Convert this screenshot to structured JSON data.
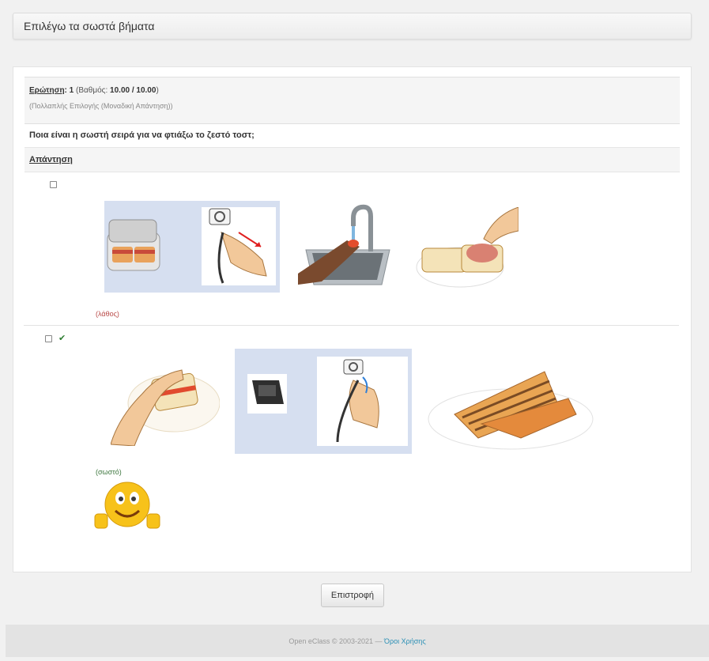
{
  "page": {
    "title": "Επιλέγω τα σωστά βήματα"
  },
  "question": {
    "label": "Ερώτηση",
    "number_suffix": ": 1",
    "grade_label": "(Βαθμός: ",
    "grade_value": "10.00 / 10.00",
    "grade_close": ")",
    "type": "(Πολλαπλής Επιλογής (Μοναδική Απάντηση))",
    "text": "Ποια είναι η σωστή σειρά για να φτιάξω το ζεστό τοστ;"
  },
  "answer_header": "Απάντηση",
  "options": [
    {
      "checked": false,
      "result": "(λάθος)",
      "icons": [
        "sandwich-maker-icon",
        "plug-in-icon",
        "wash-hands-icon",
        "ham-on-bread-icon"
      ]
    },
    {
      "checked": true,
      "correct": true,
      "result": "(σωστό)",
      "icons": [
        "closed-sandwich-icon",
        "unplug-icon",
        "grilled-toast-icon",
        "smiley-thumbs-up-icon"
      ]
    }
  ],
  "buttons": {
    "back": "Επιστροφή"
  },
  "footer": {
    "copyright": "Open eClass © 2003-2021 — ",
    "terms": "Όροι Χρήσης"
  },
  "colors": {
    "wrong": "#b94a48",
    "correct": "#3c763d",
    "link": "#2a8fb5",
    "pictogram_bg": "#d6dff0"
  }
}
